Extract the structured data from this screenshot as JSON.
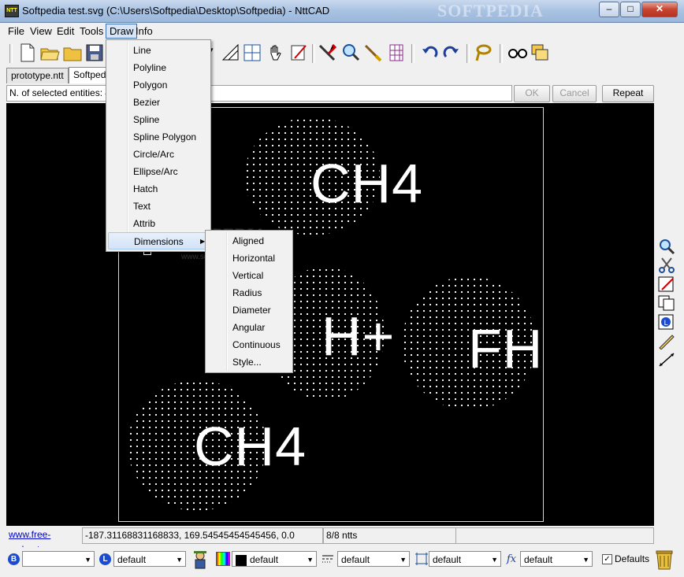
{
  "window": {
    "app_icon_text": "NTT",
    "title": "Softpedia test.svg (C:\\Users\\Softpedia\\Desktop\\Softpedia) - NttCAD",
    "watermark": "SOFTPEDIA",
    "buttons": {
      "minimize": "–",
      "maximize": "□",
      "close": "✕"
    }
  },
  "menubar": {
    "items": [
      "File",
      "View",
      "Edit",
      "Tools",
      "Draw",
      "Info"
    ],
    "active": "Draw"
  },
  "tabs": [
    {
      "label": "prototype.ntt",
      "selected": false
    },
    {
      "label": "Softpedia",
      "selected": true
    }
  ],
  "command_row": {
    "status_text": "N. of selected entities: 4",
    "ok": "OK",
    "cancel": "Cancel",
    "repeat": "Repeat"
  },
  "draw_menu": {
    "items": [
      "Line",
      "Polyline",
      "Polygon",
      "Bezier",
      "Spline",
      "Spline Polygon",
      "Circle/Arc",
      "Ellipse/Arc",
      "Hatch",
      "Text",
      "Attrib",
      "Dimensions"
    ],
    "highlighted": "Dimensions"
  },
  "dimensions_submenu": {
    "items": [
      "Aligned",
      "Horizontal",
      "Vertical",
      "Radius",
      "Diameter",
      "Angular",
      "Continuous",
      "Style..."
    ]
  },
  "canvas": {
    "labels": [
      "CH4",
      "H+",
      "FH",
      "CH4"
    ],
    "watermark": "SOFTPEDIA",
    "watermark_url": "www.softpedia.com"
  },
  "statusbar": {
    "link": "www.free-cad.net",
    "coordinates": "-187.31168831168833, 169.54545454545456, 0.0",
    "entities": "8/8 ntts"
  },
  "propbar": {
    "block_value": "",
    "layer_value": "default",
    "color_value": "default",
    "linetype_value": "default",
    "hatch_value": "default",
    "textstyle_value": "default",
    "defaults_label": "Defaults"
  }
}
